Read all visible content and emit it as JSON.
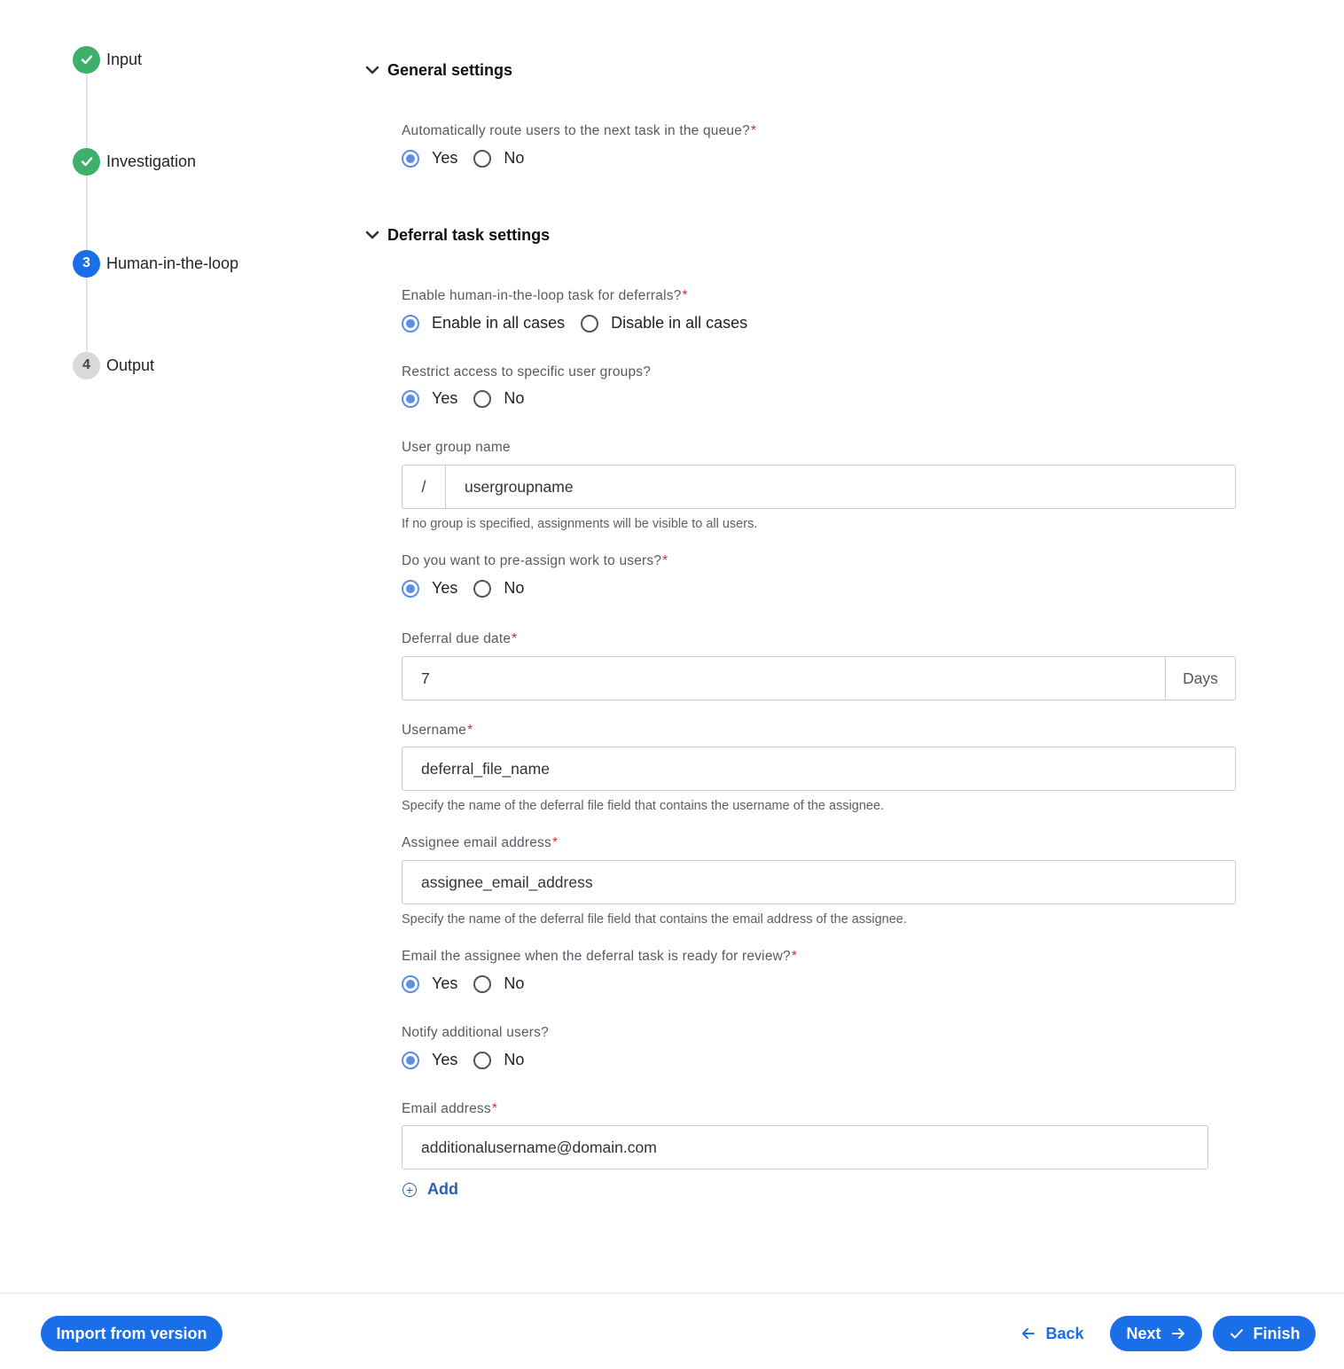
{
  "stepper": {
    "steps": [
      {
        "badge": "",
        "label": "Input",
        "state": "done"
      },
      {
        "badge": "",
        "label": "Investigation",
        "state": "done"
      },
      {
        "badge": "3",
        "label": "Human-in-the-loop",
        "state": "current"
      },
      {
        "badge": "4",
        "label": "Output",
        "state": "todo"
      }
    ]
  },
  "general": {
    "title": "General settings",
    "route_question": "Automatically route users to the next task in the queue?",
    "route_options": [
      "Yes",
      "No"
    ],
    "route_selected": "Yes"
  },
  "deferral": {
    "title": "Deferral task settings",
    "enable_question": "Enable human-in-the-loop task for deferrals?",
    "enable_options": [
      "Enable in all cases",
      "Disable in all cases"
    ],
    "enable_selected": "Enable in all cases",
    "restrict_question": "Restrict access to specific user groups?",
    "restrict_options": [
      "Yes",
      "No"
    ],
    "restrict_selected": "Yes",
    "group_label": "User group name",
    "group_prefix": "/",
    "group_value": "usergroupname",
    "group_help": "If no group is specified, assignments will be visible to all users.",
    "preassign_question": "Do you want to pre-assign work to users?",
    "preassign_options": [
      "Yes",
      "No"
    ],
    "preassign_selected": "Yes",
    "due_label": "Deferral due date",
    "due_value": "7",
    "due_unit": "Days",
    "username_label": "Username",
    "username_value": "deferral_file_name",
    "username_help": "Specify the name of the deferral file field that contains the username of the assignee.",
    "assignee_email_label": "Assignee email address",
    "assignee_email_value": "assignee_email_address",
    "assignee_email_help": "Specify the name of the deferral file field that contains the email address of the assignee.",
    "email_ready_question": "Email the assignee when the deferral task is ready for review?",
    "email_ready_options": [
      "Yes",
      "No"
    ],
    "email_ready_selected": "Yes",
    "notify_question": "Notify additional users?",
    "notify_options": [
      "Yes",
      "No"
    ],
    "notify_selected": "Yes",
    "email_label": "Email address",
    "email_value": "additionalusername@domain.com",
    "add_label": "Add"
  },
  "required_marker": "*",
  "footer": {
    "import_label": "Import from version",
    "back_label": "Back",
    "next_label": "Next",
    "finish_label": "Finish"
  },
  "colors": {
    "primary": "#1a6fe8",
    "success": "#3fb06a",
    "radio_checked": "#5b8ee6",
    "required": "#d23030"
  }
}
